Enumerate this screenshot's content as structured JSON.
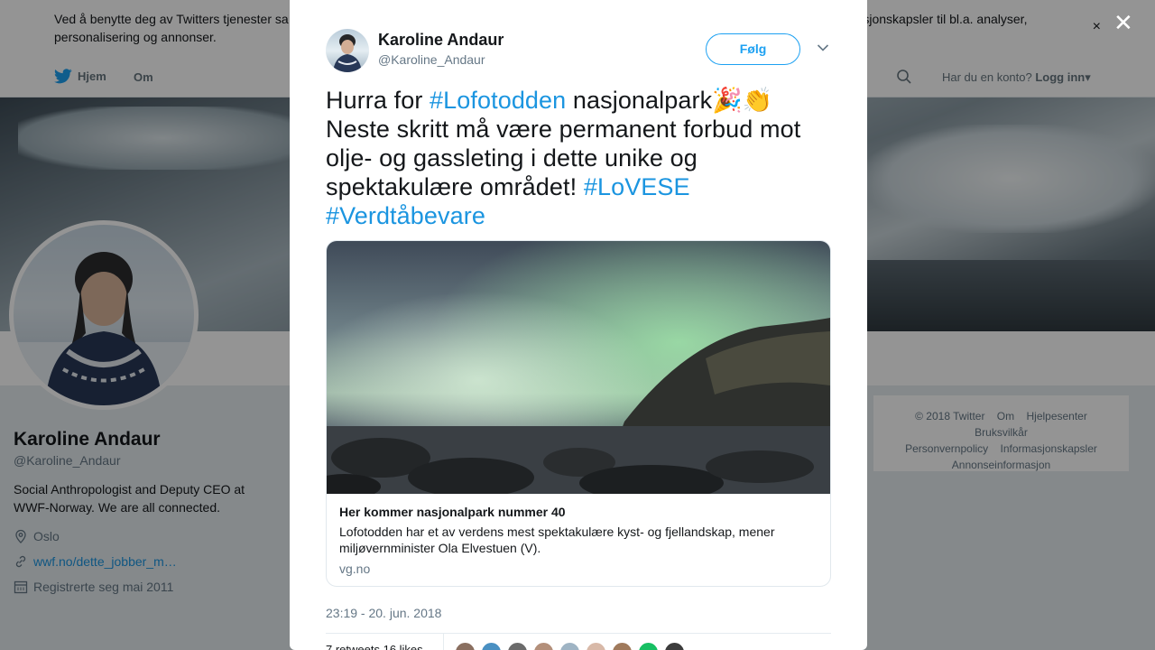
{
  "cookie_bar": {
    "text_left": "Ved å benytte deg av Twitters tjenester sa",
    "text_right": "informasjonskapsler til bl.a. analyser,",
    "text_line2": "personalisering og annonser.",
    "close_glyph": "×"
  },
  "nav": {
    "home_label": "Hjem",
    "about_label": "Om",
    "login_prompt": "Har du en konto?",
    "login_label": "Logg inn",
    "login_caret": "▾"
  },
  "profile": {
    "name": "Karoline Andaur",
    "handle": "@Karoline_Andaur",
    "bio": "Social Anthropologist and Deputy CEO at WWF-Norway. We are all connected.",
    "location": "Oslo",
    "website": "wwf.no/dette_jobber_m…",
    "joined": "Registrerte seg mai 2011"
  },
  "footer": {
    "copyright": "© 2018 Twitter",
    "links": [
      "Om",
      "Hjelpesenter",
      "Bruksvilkår",
      "Personvernpolicy",
      "Informasjonskapsler",
      "Annonseinformasjon"
    ]
  },
  "overlay": {
    "close_glyph": "✕"
  },
  "tweet": {
    "author_name": "Karoline Andaur",
    "author_handle": "@Karoline_Andaur",
    "follow_label": "Følg",
    "text": {
      "part1": "Hurra for ",
      "hashtag1": "#Lofotodden",
      "part2": " nasjonalpark🎉👏 Neste skritt må være permanent forbud mot olje- og gassleting i dette unike og spektakulære området! ",
      "hashtag2": "#LoVESE",
      "hashtag3": "#Verdtåbevare"
    },
    "card": {
      "title": "Her kommer nasjonalpark nummer 40",
      "description": "Lofotodden har et av verdens mest spektakulære kyst- og fjellandskap, mener miljøvernminister Ola Elvestuen (V).",
      "domain": "vg.no"
    },
    "timestamp": "23:19 - 20. jun. 2018",
    "stats_label": "7 retweets 16 likes",
    "liker_colors": [
      "#8a6f60",
      "#4a90c2",
      "#6b6b6b",
      "#b38f7a",
      "#9fb4c4",
      "#d8b9a8",
      "#a07a5c",
      "#17bf63",
      "#3c3c3c"
    ]
  },
  "colors": {
    "accent": "#1da1f2",
    "link": "#1b95e0",
    "muted": "#657786"
  },
  "icons": {
    "twitter": "twitter-bird-icon",
    "search": "search-icon",
    "location": "location-pin-icon",
    "link": "link-icon",
    "calendar": "calendar-icon",
    "caret": "chevron-down-icon"
  }
}
